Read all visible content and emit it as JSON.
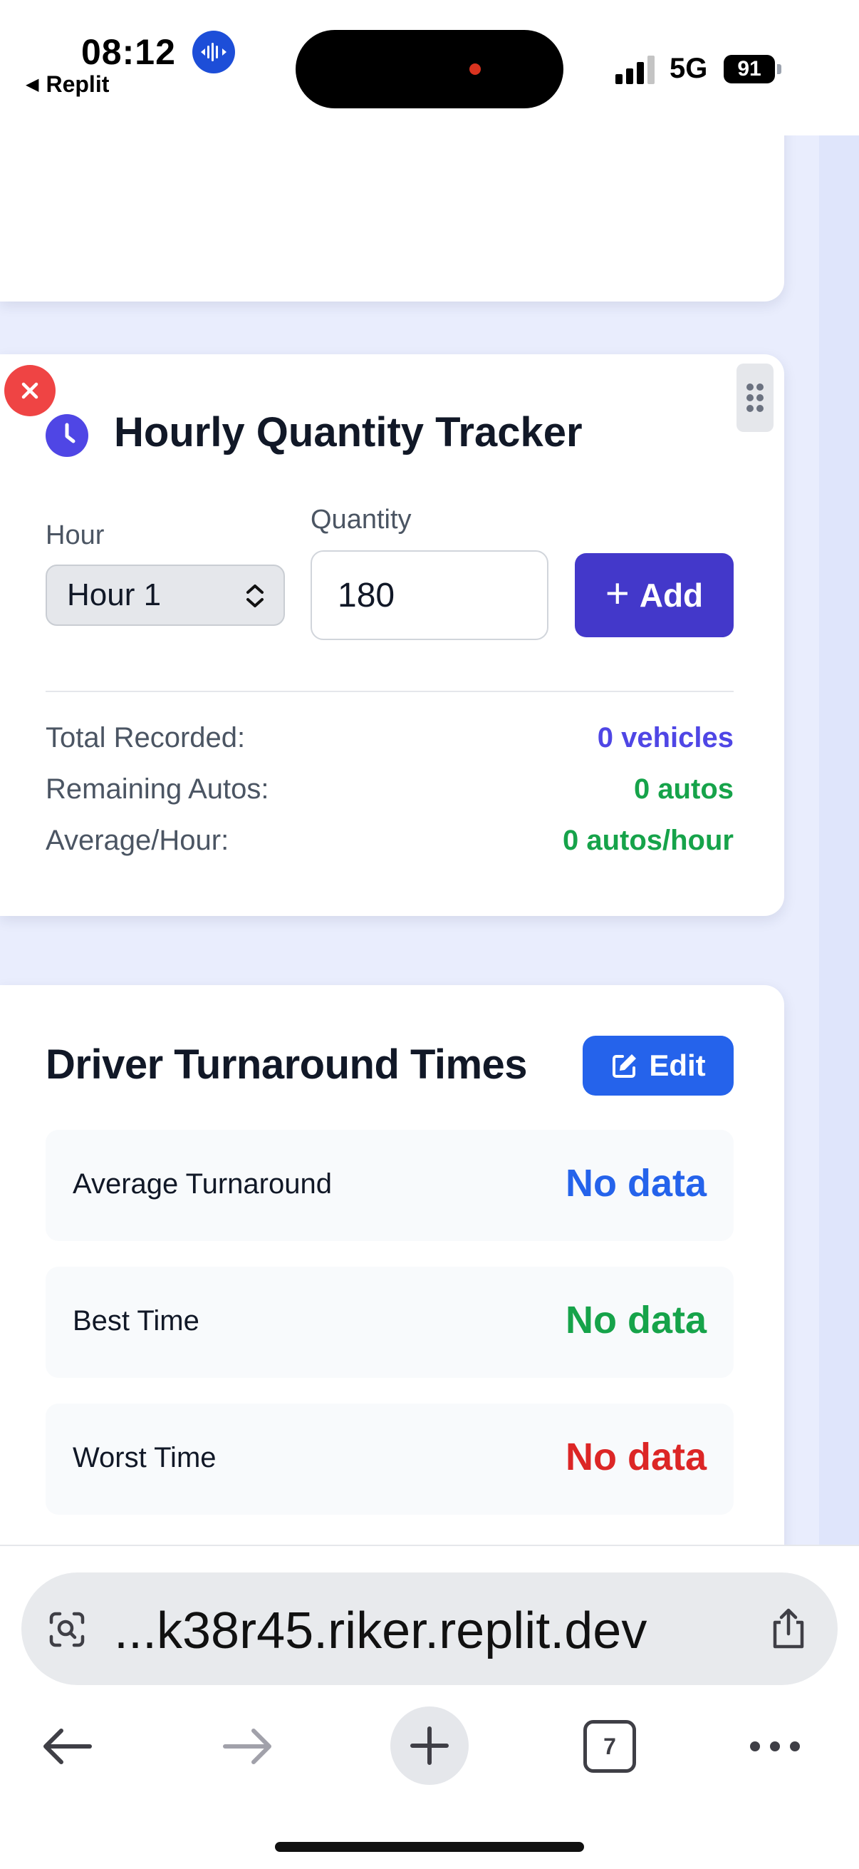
{
  "status_bar": {
    "time": "08:12",
    "back_app": "Replit",
    "network": "5G",
    "battery": "91"
  },
  "tracker": {
    "title": "Hourly Quantity Tracker",
    "hour_label": "Hour",
    "hour_value": "Hour 1",
    "quantity_label": "Quantity",
    "quantity_value": "180",
    "add_label": "Add",
    "stats": [
      {
        "label": "Total Recorded:",
        "value": "0 vehicles",
        "color": "#4f46e5"
      },
      {
        "label": "Remaining Autos:",
        "value": "0 autos",
        "color": "#16a34a"
      },
      {
        "label": "Average/Hour:",
        "value": "0 autos/hour",
        "color": "#16a34a"
      }
    ]
  },
  "driver": {
    "title": "Driver Turnaround Times",
    "edit_label": "Edit",
    "metrics": [
      {
        "label": "Average Turnaround",
        "value": "No data",
        "color": "#2563eb"
      },
      {
        "label": "Best Time",
        "value": "No data",
        "color": "#16a34a"
      },
      {
        "label": "Worst Time",
        "value": "No data",
        "color": "#dc2626"
      }
    ]
  },
  "browser": {
    "url": "...k38r45.riker.replit.dev",
    "tab_count": "7"
  },
  "icons": {
    "audio": "audio-waveform-icon",
    "clock": "clock-icon",
    "remove": "close-icon",
    "drag": "drag-handle-icon",
    "edit": "edit-icon",
    "lens": "page-lens-icon",
    "share": "share-icon"
  }
}
